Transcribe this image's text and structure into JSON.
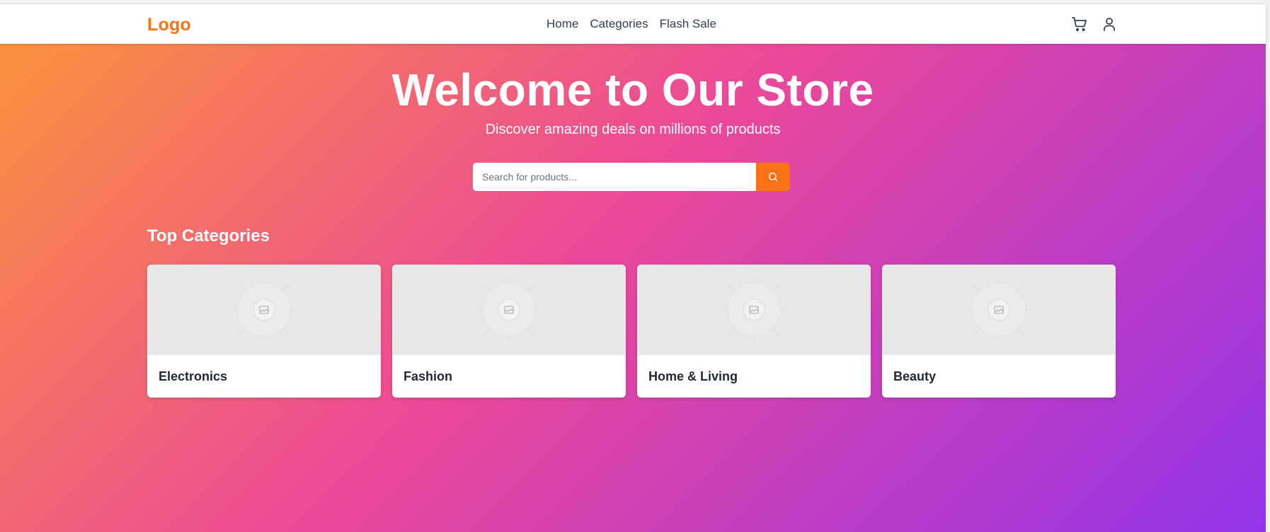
{
  "brand": {
    "logo": "Logo"
  },
  "nav": {
    "links": [
      "Home",
      "Categories",
      "Flash Sale"
    ],
    "icons": [
      "cart-icon",
      "user-icon"
    ]
  },
  "hero": {
    "title": "Welcome to Our Store",
    "subtitle": "Discover amazing deals on millions of products"
  },
  "search": {
    "placeholder": "Search for products...",
    "value": "",
    "button_icon": "search-icon"
  },
  "categories": {
    "title": "Top Categories",
    "items": [
      {
        "label": "Electronics",
        "image_icon": "image-placeholder-icon"
      },
      {
        "label": "Fashion",
        "image_icon": "image-placeholder-icon"
      },
      {
        "label": "Home & Living",
        "image_icon": "image-placeholder-icon"
      },
      {
        "label": "Beauty",
        "image_icon": "image-placeholder-icon"
      }
    ]
  },
  "colors": {
    "accent": "#f97316",
    "gradient_start": "#fb923c",
    "gradient_mid": "#ec4899",
    "gradient_end": "#9333ea",
    "nav_text": "#374151",
    "card_text": "#1f2937"
  }
}
